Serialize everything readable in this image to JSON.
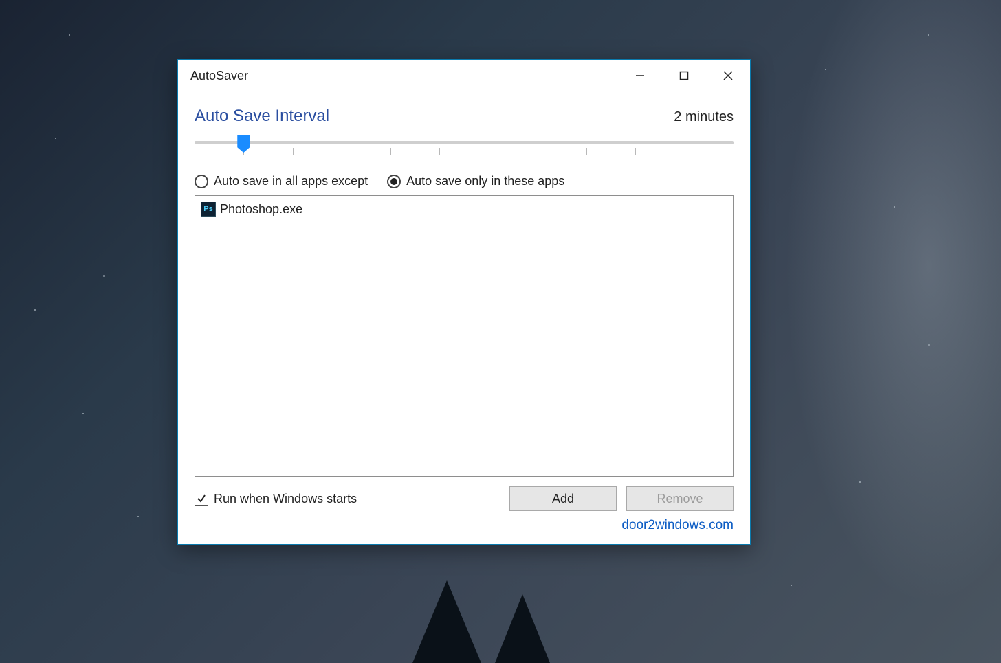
{
  "window": {
    "title": "AutoSaver"
  },
  "interval": {
    "heading": "Auto Save Interval",
    "value_label": "2 minutes",
    "value_num": 2,
    "min": 1,
    "max": 60,
    "tick_count": 12
  },
  "radios": {
    "except_label": "Auto save in all apps except",
    "only_label": "Auto save only in these apps",
    "selected": "only"
  },
  "app_list": [
    {
      "icon_text": "Ps",
      "name": "Photoshop.exe"
    }
  ],
  "startup": {
    "label": "Run when Windows starts",
    "checked": true
  },
  "buttons": {
    "add": "Add",
    "remove": "Remove",
    "remove_disabled": true
  },
  "link": {
    "text": "door2windows.com"
  }
}
